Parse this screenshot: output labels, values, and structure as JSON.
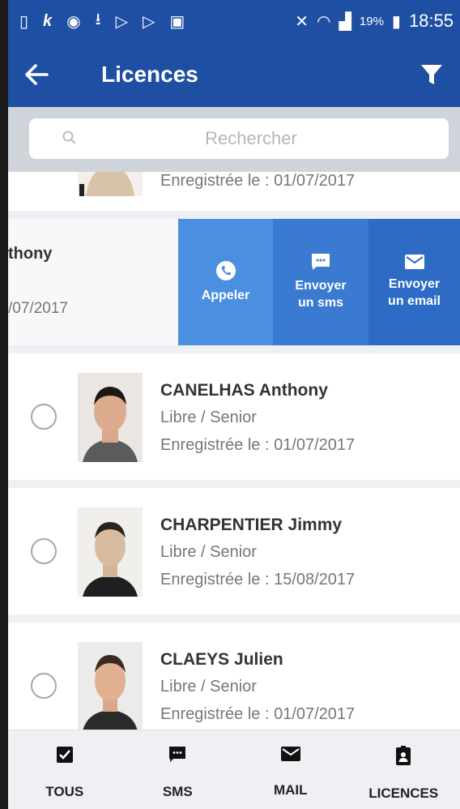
{
  "status_bar": {
    "battery": "19%",
    "time": "18:55"
  },
  "app_bar": {
    "title": "Licences"
  },
  "search": {
    "placeholder": "Rechercher"
  },
  "list": {
    "partial_top": {
      "registered": "Enregistrée le : 01/07/2017"
    },
    "swiped_row": {
      "name_fragment": "thony",
      "date_fragment": "/07/2017",
      "actions": {
        "call": "Appeler",
        "sms_line1": "Envoyer",
        "sms_line2": "un sms",
        "email_line1": "Envoyer",
        "email_line2": "un email"
      }
    },
    "items": [
      {
        "name": "CANELHAS Anthony",
        "category": "Libre / Senior",
        "registered": "Enregistrée le : 01/07/2017"
      },
      {
        "name": "CHARPENTIER Jimmy",
        "category": "Libre / Senior",
        "registered": "Enregistrée le : 15/08/2017"
      },
      {
        "name": "CLAEYS Julien",
        "category": "Libre / Senior",
        "registered": "Enregistrée le : 01/07/2017"
      }
    ]
  },
  "bottom_nav": {
    "tabs": [
      {
        "label": "TOUS",
        "icon": "checkbox-icon"
      },
      {
        "label": "SMS",
        "icon": "sms-icon"
      },
      {
        "label": "MAIL",
        "icon": "mail-icon"
      },
      {
        "label": "LICENCES",
        "icon": "id-badge-icon"
      }
    ]
  },
  "colors": {
    "primary": "#1f4fa3",
    "action_call": "#4a8fe0",
    "action_sms": "#3a7ad0",
    "action_mail": "#2e6bc4"
  }
}
